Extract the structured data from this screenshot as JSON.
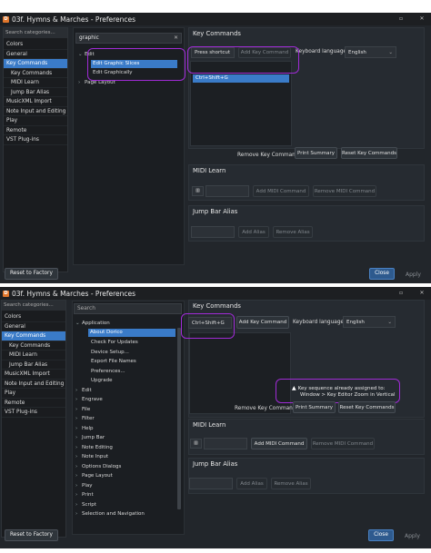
{
  "window1": {
    "title": "03f. Hymns  &  Marches - Preferences",
    "search_placeholder": "Search categories...",
    "categories": [
      "Colors",
      "General",
      "Key Commands",
      "Key Commands",
      "MIDI Learn",
      "Jump Bar Alias",
      "MusicXML Import",
      "Note Input and Editing",
      "Play",
      "Remote",
      "VST Plug-ins"
    ],
    "filter_value": "graphic",
    "tree": {
      "edit": "Edit",
      "edit_graphic_slices": "Edit Graphic Slices",
      "edit_graphically": "Edit Graphically",
      "page_layout": "Page Layout"
    },
    "key_commands": {
      "title": "Key Commands",
      "press_shortcut_placeholder": "Press shortcut",
      "add_key_command": "Add Key Command",
      "keyboard_language_label": "Keyboard language:",
      "keyboard_language": "English",
      "shortcut": "Ctrl+Shift+G",
      "remove_key_command": "Remove Key Command",
      "print_summary": "Print Summary",
      "reset_key_commands": "Reset Key Commands"
    },
    "midi_learn": {
      "title": "MIDI Learn",
      "add_midi_command": "Add MIDI Command",
      "remove_midi_command": "Remove MIDI Command"
    },
    "jump_bar_alias": {
      "title": "Jump Bar Alias",
      "add_alias": "Add Alias",
      "remove_alias": "Remove Alias"
    },
    "reset_to_factory": "Reset to Factory",
    "close": "Close",
    "apply": "Apply"
  },
  "window2": {
    "title": "03f. Hymns  &  Marches - Preferences",
    "search_placeholder": "Search categories...",
    "categories": [
      "Colors",
      "General",
      "Key Commands",
      "Key Commands",
      "MIDI Learn",
      "Jump Bar Alias",
      "MusicXML Import",
      "Note Input and Editing",
      "Play",
      "Remote",
      "VST Plug-ins"
    ],
    "filter_placeholder": "Search",
    "tree_application": "Application",
    "tree_application_children": [
      "About Dorico",
      "Check For Updates",
      "Device Setup...",
      "Export File Names",
      "Preferences...",
      "Upgrade"
    ],
    "tree_items": [
      "Edit",
      "Engrave",
      "File",
      "Filter",
      "Help",
      "Jump Bar",
      "Note Editing",
      "Note Input",
      "Options Dialogs",
      "Page Layout",
      "Play",
      "Print",
      "Script",
      "Selection and Navigation"
    ],
    "key_commands": {
      "title": "Key Commands",
      "shortcut_value": "Ctrl+Shift+G",
      "add_key_command": "Add Key Command",
      "keyboard_language_label": "Keyboard language:",
      "keyboard_language": "English",
      "warning_line1": "Key sequence already assigned to:",
      "warning_line2": "Window > Key Editor Zoom in Vertical",
      "remove_key_command": "Remove Key Command",
      "print_summary": "Print Summary",
      "reset_key_commands": "Reset Key Commands"
    },
    "midi_learn": {
      "title": "MIDI Learn",
      "add_midi_command": "Add MIDI Command",
      "remove_midi_command": "Remove MIDI Command"
    },
    "jump_bar_alias": {
      "title": "Jump Bar Alias",
      "add_alias": "Add Alias",
      "remove_alias": "Remove Alias"
    },
    "reset_to_factory": "Reset to Factory",
    "close": "Close",
    "apply": "Apply"
  },
  "colors": {
    "accent": "#3a7bc8",
    "highlight": "#a02bd6",
    "background": "#22262b"
  },
  "icons": {
    "app": "dorico-icon",
    "minimize": "minimize-icon",
    "maximize": "maximize-icon",
    "close": "close-icon",
    "clear": "clear-search-icon",
    "midi": "midi-keyboard-icon",
    "warning": "warning-icon"
  }
}
